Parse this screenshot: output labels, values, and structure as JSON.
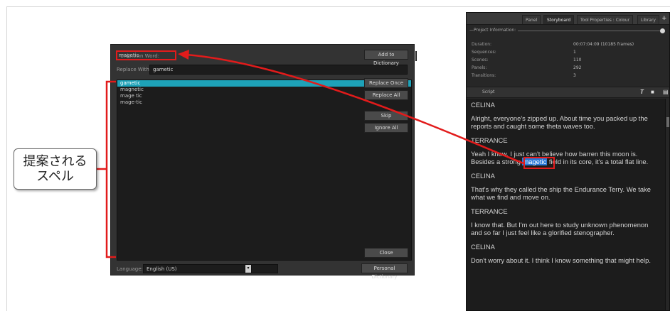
{
  "dialog": {
    "unknown_word_label": "Unknown Word:",
    "unknown_word": "magetic",
    "replace_with_label": "Replace With:",
    "replace_with_value": "gametic",
    "suggestions": [
      "gametic",
      "magnetic",
      "mage tic",
      "mage-tic"
    ],
    "selected_suggestion_index": 0,
    "buttons": {
      "add_to_dictionary": "Add to Dictionary",
      "replace_once": "Replace Once",
      "replace_all": "Replace All",
      "skip": "Skip",
      "ignore_all": "Ignore All",
      "close": "Close",
      "personal_dictionary": "Personal Dictionary"
    },
    "language_label": "Language:",
    "language_value": "English (US)"
  },
  "panel": {
    "tabs": [
      "Panel",
      "Storyboard",
      "Tool Properties : Colour",
      "Library"
    ],
    "active_tab": "Storyboard",
    "project_info_title": "Project Information:",
    "info": [
      {
        "key": "Duration:",
        "value": "00:07:04:09  (10185 frames)"
      },
      {
        "key": "Sequences:",
        "value": "1"
      },
      {
        "key": "Scenes:",
        "value": "110"
      },
      {
        "key": "Panels:",
        "value": "292"
      },
      {
        "key": "Transitions:",
        "value": "3"
      }
    ],
    "script_title": "Script",
    "script": {
      "n1": "CELINA",
      "l1": "Alright, everyone's zipped up. About time you packed up the reports and caught some theta waves too.",
      "n2": "TERRANCE",
      "l2_pre": "Yeah I know. I just can't believe how barren this moon is. Besides a strong ",
      "l2_word": "magetic",
      "l2_post": " field in its core, it's a total flat line.",
      "n3": "CELINA",
      "l3": "That's why they called the ship the Endurance Terry. We take what we find and move on.",
      "n4": "TERRANCE",
      "l4": "I know that. But I'm out here to study unknown phenomenon and so far I just feel like a glorified stenographer.",
      "n5": "CELINA",
      "l5": "Don't worry about it. I think I know something that might help."
    }
  },
  "callout": {
    "line1": "提案される",
    "line2": "スペル"
  },
  "colors": {
    "highlight": "#1ea2b8",
    "annotation_red": "#e21b1b",
    "selection_blue": "#2a79d8"
  }
}
